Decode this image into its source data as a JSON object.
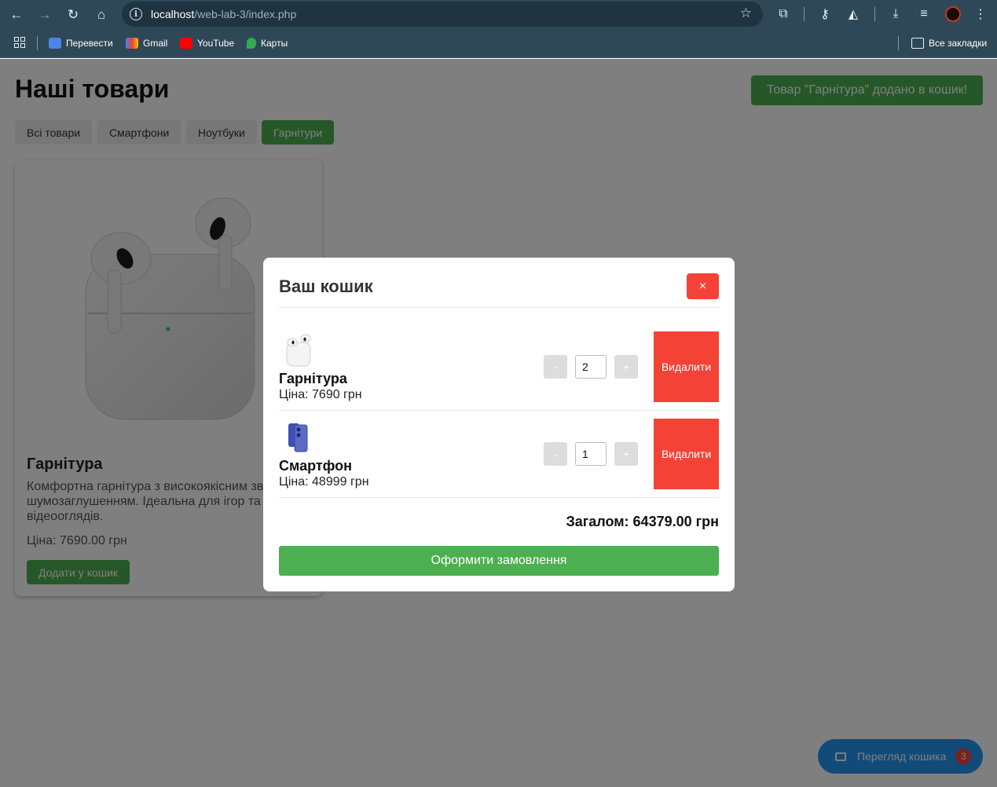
{
  "browser": {
    "url_host": "localhost",
    "url_path": "/web-lab-3/index.php",
    "bookmarks": [
      "Перевести",
      "Gmail",
      "YouTube",
      "Карты"
    ],
    "all_bookmarks": "Все закладки"
  },
  "page": {
    "title": "Наші товари",
    "toast": "Товар \"Гарнітура\" додано в кошик!",
    "filters": [
      "Всі товари",
      "Смартфони",
      "Ноутбуки",
      "Гарнітури"
    ],
    "active_filter": "Гарнітури",
    "product": {
      "title": "Гарнітура",
      "description_line1": "Комфортна гарнітура з високоякісним звуком та",
      "description_line2": "шумозаглушенням. Ідеальна для ігор та",
      "description_line3": "відеооглядів.",
      "price": "Ціна: 7690.00 грн",
      "add_button": "Додати у кошик"
    },
    "cart_button": {
      "label": "Перегляд кошика",
      "count": "3"
    }
  },
  "modal": {
    "title": "Ваш кошик",
    "close": "×",
    "items": [
      {
        "name": "Гарнітура",
        "price": "Ціна: 7690 грн",
        "quantity": "2",
        "minus": "-",
        "plus": "+",
        "remove": "Видалити"
      },
      {
        "name": "Смартфон",
        "price": "Ціна: 48999 грн",
        "quantity": "1",
        "minus": "-",
        "plus": "+",
        "remove": "Видалити"
      }
    ],
    "total": "Загалом: 64379.00 грн",
    "checkout": "Оформити замовлення"
  },
  "colors": {
    "green": "#4caf50",
    "red": "#f44336",
    "blue": "#2196f3"
  }
}
